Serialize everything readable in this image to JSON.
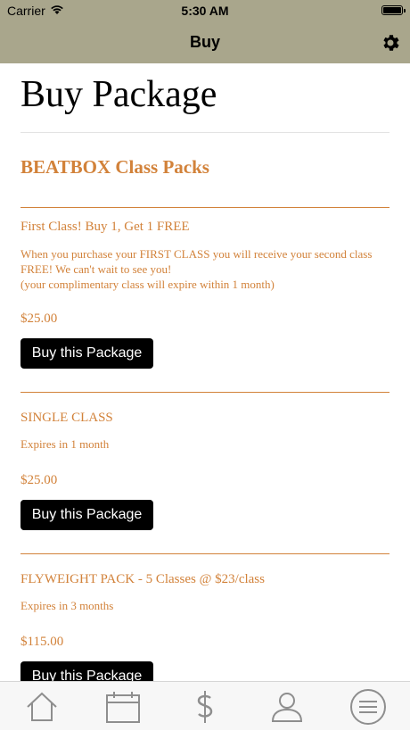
{
  "status_bar": {
    "carrier": "Carrier",
    "time": "5:30 AM"
  },
  "nav": {
    "title": "Buy",
    "settings_icon": "gear-icon"
  },
  "page": {
    "title": "Buy Package"
  },
  "section": {
    "title": "BEATBOX Class Packs"
  },
  "packages": [
    {
      "name": "First Class! Buy 1, Get 1 FREE",
      "description_lines": [
        "When you purchase your FIRST CLASS you will receive your second class",
        "FREE! We can't wait to see you!",
        "(your complimentary class will expire within 1 month)"
      ],
      "price": "$25.00",
      "button_label": "Buy this Package"
    },
    {
      "name": "SINGLE CLASS",
      "description_lines": [
        "Expires in 1 month"
      ],
      "price": "$25.00",
      "button_label": "Buy this Package"
    },
    {
      "name": "FLYWEIGHT PACK - 5 Classes @ $23/class",
      "description_lines": [
        "Expires in 3 months"
      ],
      "price": "$115.00",
      "button_label": "Buy this Package"
    }
  ],
  "tab_bar": {
    "tabs": [
      {
        "icon": "home-icon"
      },
      {
        "icon": "calendar-icon"
      },
      {
        "icon": "dollar-icon"
      },
      {
        "icon": "user-icon"
      },
      {
        "icon": "menu-icon"
      }
    ]
  },
  "colors": {
    "accent": "#d2823a",
    "nav_background": "#a9a68c",
    "button": "#000000"
  }
}
